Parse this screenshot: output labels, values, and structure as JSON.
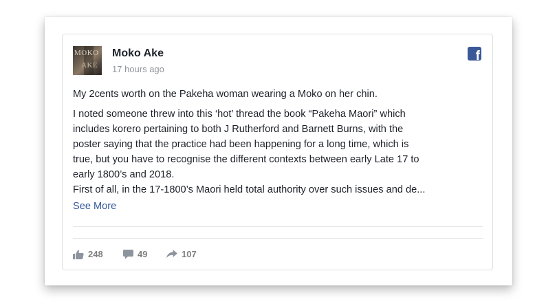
{
  "post": {
    "author": "Moko Ake",
    "timestamp": "17 hours ago",
    "avatar": {
      "line1": "MOKO",
      "line2": "AKE"
    },
    "platform_icon": "facebook-icon",
    "body": [
      "My 2cents worth on the Pakeha woman wearing a Moko on her chin.",
      "I noted someone threw into this ‘hot’ thread the book “Pakeha Maori” which",
      "includes korero pertaining to both J Rutherford and Barnett Burns, with the",
      "poster saying that the practice had been happening for a long time, which is",
      "true, but you have to recognise the different contexts between early Late 17 to",
      "early 1800’s and 2018.",
      "First of all, in the 17-1800’s Maori held total authority over such issues and de..."
    ],
    "see_more": "See More",
    "stats": {
      "likes": "248",
      "comments": "49",
      "shares": "107"
    }
  },
  "colors": {
    "facebook_blue": "#3b5998",
    "link": "#365899",
    "text": "#1d2129",
    "muted": "#90949c"
  }
}
